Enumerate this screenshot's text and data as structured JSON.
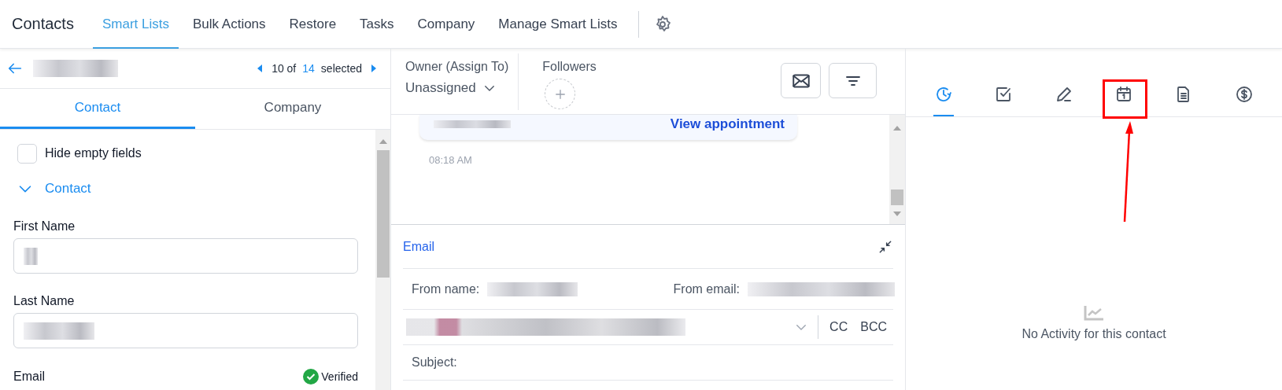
{
  "header": {
    "title": "Contacts",
    "nav": [
      {
        "label": "Smart Lists",
        "selected": true
      },
      {
        "label": "Bulk Actions",
        "selected": false
      },
      {
        "label": "Restore",
        "selected": false
      },
      {
        "label": "Tasks",
        "selected": false
      },
      {
        "label": "Company",
        "selected": false
      },
      {
        "label": "Manage Smart Lists",
        "selected": false
      }
    ]
  },
  "contact_panel": {
    "pager": {
      "position": "10 of",
      "total": "14",
      "suffix": "selected"
    },
    "tabs": [
      {
        "label": "Contact",
        "selected": true
      },
      {
        "label": "Company",
        "selected": false
      }
    ],
    "hide_empty": {
      "label": "Hide empty fields",
      "checked": false
    },
    "section": {
      "label": "Contact",
      "expanded": true
    },
    "fields": [
      {
        "label": "First Name"
      },
      {
        "label": "Last Name"
      },
      {
        "label": "Email",
        "badge": "Verified"
      }
    ]
  },
  "conversation": {
    "owner": {
      "label": "Owner (Assign To)",
      "value": "Unassigned"
    },
    "followers": {
      "label": "Followers"
    },
    "appointment_link": "View appointment",
    "time": "08:18 AM",
    "composer": {
      "title": "Email",
      "from_name": "From name:",
      "from_email": "From email:",
      "cc": "CC",
      "bcc": "BCC",
      "subject": "Subject:"
    }
  },
  "activity": {
    "tabs": [
      {
        "kind": "history",
        "selected": true,
        "highlighted": false
      },
      {
        "kind": "task",
        "selected": false,
        "highlighted": false
      },
      {
        "kind": "note",
        "selected": false,
        "highlighted": false
      },
      {
        "kind": "calendar",
        "selected": false,
        "highlighted": true
      },
      {
        "kind": "document",
        "selected": false,
        "highlighted": false
      },
      {
        "kind": "payment",
        "selected": false,
        "highlighted": false
      }
    ],
    "empty": "No Activity for this contact"
  }
}
